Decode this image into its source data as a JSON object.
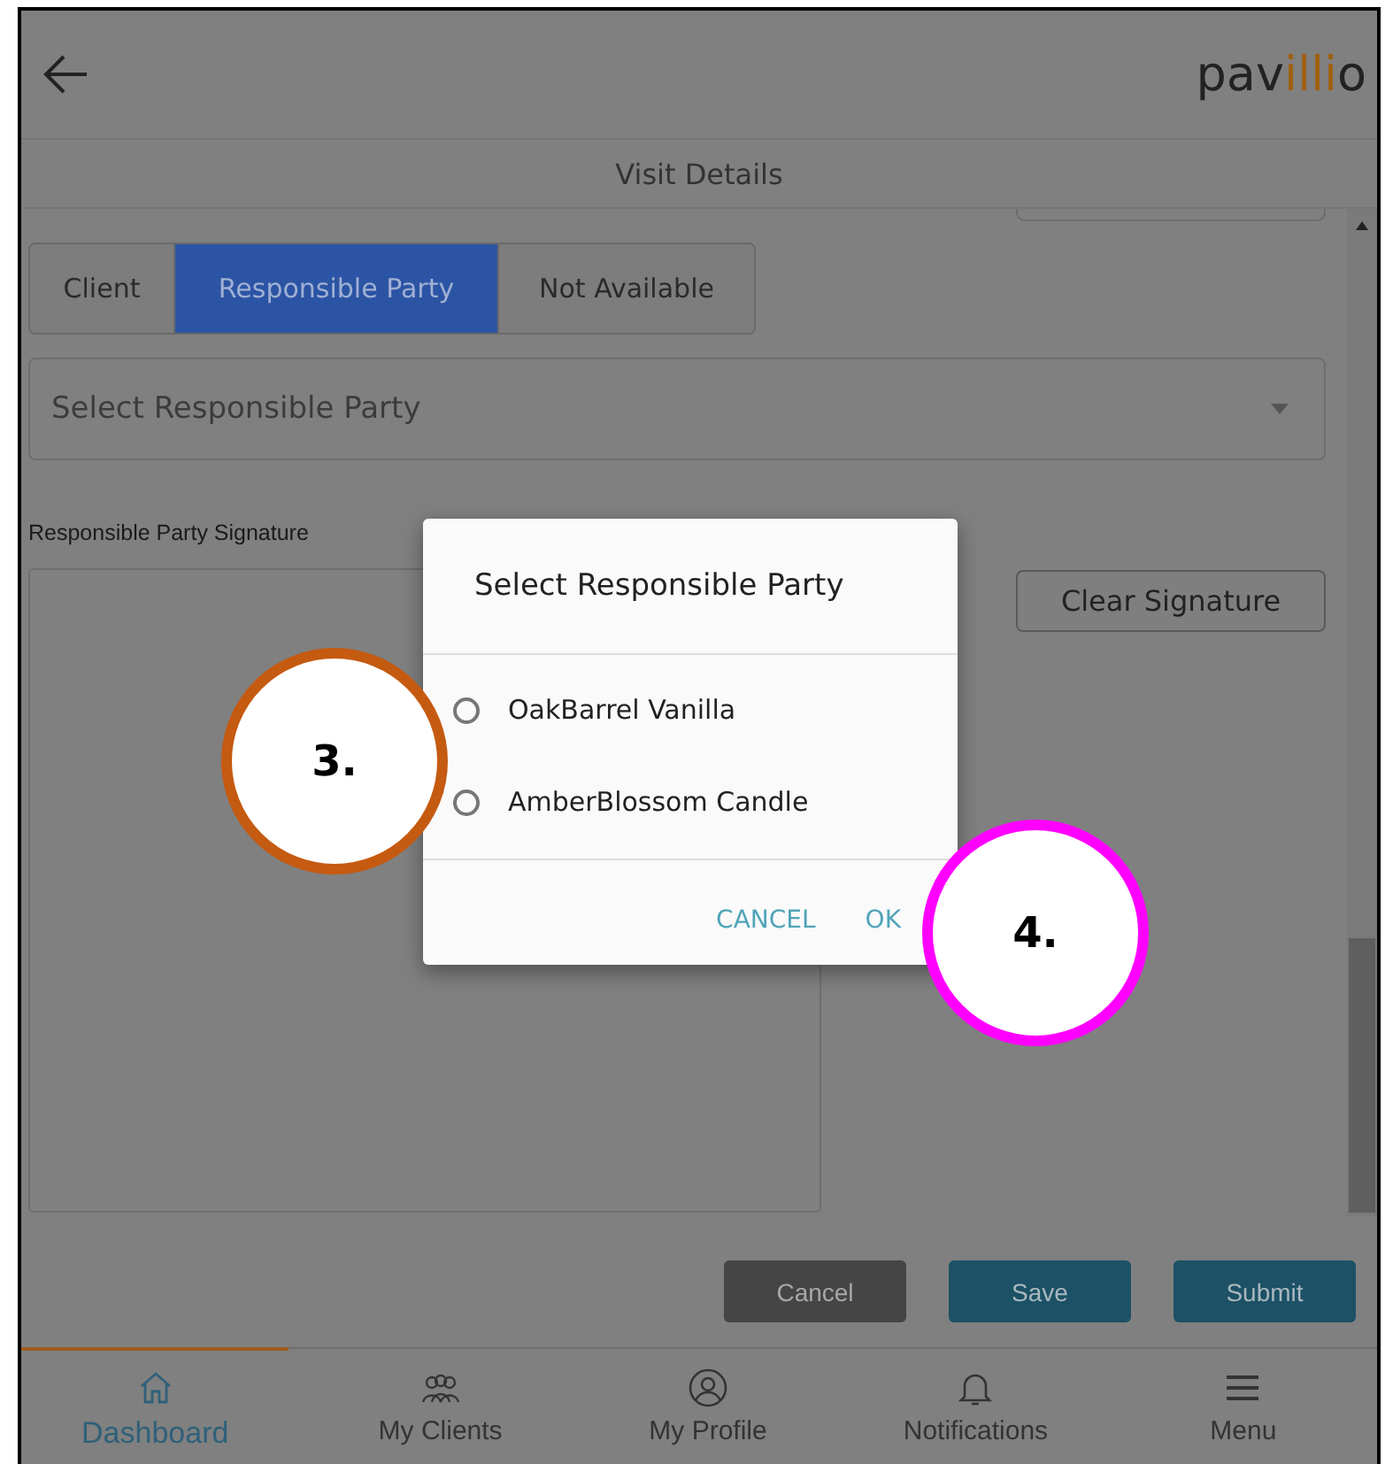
{
  "header": {
    "logo": [
      {
        "text": "pav",
        "accent": false
      },
      {
        "text": "illi",
        "accent": true
      },
      {
        "text": "o",
        "accent": false
      }
    ]
  },
  "page_title": "Visit Details",
  "tabs": [
    {
      "label": "Client",
      "selected": false
    },
    {
      "label": "Responsible Party",
      "selected": true
    },
    {
      "label": "Not Available",
      "selected": false
    }
  ],
  "party_select": {
    "placeholder": "Select Responsible Party"
  },
  "signature": {
    "label": "Responsible Party Signature",
    "clear_button": "Clear Signature"
  },
  "actions": [
    {
      "label": "Cancel",
      "kind": "secondary"
    },
    {
      "label": "Save",
      "kind": "primary"
    },
    {
      "label": "Submit",
      "kind": "primary"
    }
  ],
  "bottom_nav": [
    {
      "label": "Dashboard",
      "selected": true
    },
    {
      "label": "My Clients",
      "selected": false
    },
    {
      "label": "My Profile",
      "selected": false
    },
    {
      "label": "Notifications",
      "selected": false
    },
    {
      "label": "Menu",
      "selected": false
    }
  ],
  "dialog": {
    "title": "Select Responsible Party",
    "options": [
      {
        "label": "OakBarrel Vanilla",
        "selected": false
      },
      {
        "label": "AmberBlossom Candle",
        "selected": false
      }
    ],
    "buttons": [
      "CANCEL",
      "OK"
    ]
  },
  "callouts": [
    {
      "label": "3.",
      "color": "#c55a11"
    },
    {
      "label": "4.",
      "color": "#ff00ff"
    }
  ]
}
